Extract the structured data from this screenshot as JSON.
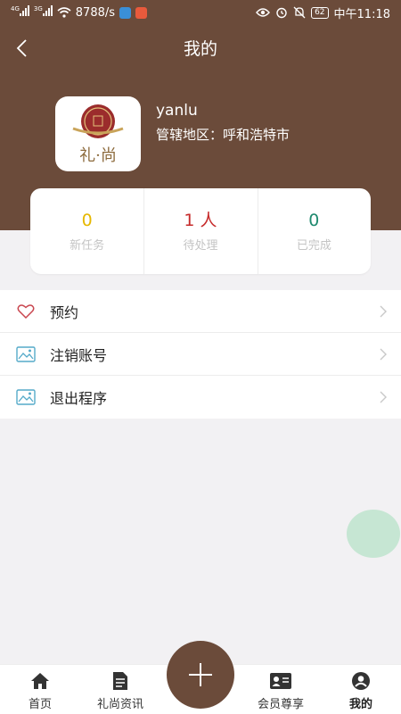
{
  "status_bar": {
    "signal_1_tag": "4G",
    "signal_2_tag": "3G",
    "speed": "8788/s",
    "battery": "62",
    "time": "中午11:18"
  },
  "header": {
    "title": "我的"
  },
  "profile": {
    "username": "yanlu",
    "region_label": "管辖地区：",
    "region_value": "呼和浩特市",
    "avatar_text": "礼·尚"
  },
  "stats": [
    {
      "value": "0",
      "label": "新任务",
      "color": "#e6b800"
    },
    {
      "value": "1 人",
      "label": "待处理",
      "color": "#c62b2b"
    },
    {
      "value": "0",
      "label": "已完成",
      "color": "#1f8a6f"
    }
  ],
  "menu": [
    {
      "label": "预约",
      "icon": "heart-icon"
    },
    {
      "label": "注销账号",
      "icon": "image-icon"
    },
    {
      "label": "退出程序",
      "icon": "image-icon"
    }
  ],
  "bottom_nav": [
    {
      "label": "首页",
      "icon": "home-icon"
    },
    {
      "label": "礼尚资讯",
      "icon": "document-icon"
    },
    {
      "label": "会员尊享",
      "icon": "member-card-icon"
    },
    {
      "label": "我的",
      "icon": "user-icon",
      "active": true
    }
  ],
  "colors": {
    "brand": "#6b4b3a",
    "accent_green": "#c6e6d3"
  }
}
